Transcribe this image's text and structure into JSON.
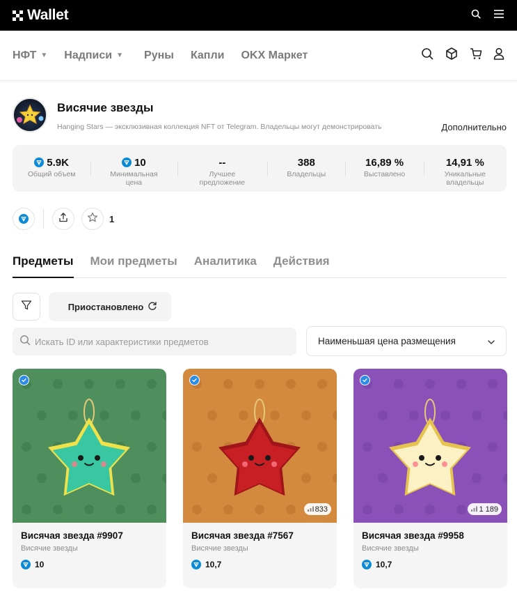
{
  "topbar": {
    "brand": "Wallet"
  },
  "nav": {
    "items": [
      {
        "label": "НФТ",
        "has_caret": true
      },
      {
        "label": "Надписи",
        "has_caret": true
      },
      {
        "label": "Руны",
        "has_caret": false
      },
      {
        "label": "Капли",
        "has_caret": false
      },
      {
        "label": "OKX Маркет",
        "has_caret": false
      }
    ],
    "icons": [
      "search-icon",
      "cube-icon",
      "cart-icon",
      "user-icon"
    ]
  },
  "collection": {
    "title": "Висячие звезды",
    "description": "Hanging Stars — эксклюзивная коллекция NFT от Telegram. Владельцы могут демонстрировать",
    "more_label": "Дополнительно"
  },
  "stats": [
    {
      "value": "5.9K",
      "label": "Общий объем",
      "ton": true
    },
    {
      "value": "10",
      "label": "Минимальная цена",
      "ton": true
    },
    {
      "value": "--",
      "label": "Лучшее предложение",
      "ton": false
    },
    {
      "value": "388",
      "label": "Владельцы",
      "ton": false
    },
    {
      "value": "16,89 %",
      "label": "Выставлено",
      "ton": false
    },
    {
      "value": "14,91 %",
      "label": "Уникальные владельцы",
      "ton": false
    }
  ],
  "actions": {
    "favorite_count": "1"
  },
  "tabs": [
    {
      "label": "Предметы",
      "active": true
    },
    {
      "label": "Мои предметы",
      "active": false
    },
    {
      "label": "Аналитика",
      "active": false
    },
    {
      "label": "Действия",
      "active": false
    }
  ],
  "filters": {
    "status_label": "Приостановлено",
    "search_placeholder": "Искать ID или характеристики предметов",
    "sort_label": "Наименьшая цена размещения"
  },
  "items": [
    {
      "title": "Висячая звезда #9907",
      "collection": "Висячие звезды",
      "price": "10",
      "rarity": "",
      "bg": "#4f8f5e",
      "star": "#39c7a2",
      "rim": "#f0e24a",
      "pattern_color": "#3f7c4e"
    },
    {
      "title": "Висячая звезда #7567",
      "collection": "Висячие звезды",
      "price": "10,7",
      "rarity": "833",
      "bg": "#d38a3e",
      "star": "#c81f24",
      "rim": "#a0151a",
      "pattern_color": "#bf7531"
    },
    {
      "title": "Висячая звезда #9958",
      "collection": "Висячие звезды",
      "price": "10,7",
      "rarity": "1 189",
      "bg": "#8a52b8",
      "star": "#fbf1c4",
      "rim": "#e6c24e",
      "pattern_color": "#7a44a6"
    }
  ]
}
